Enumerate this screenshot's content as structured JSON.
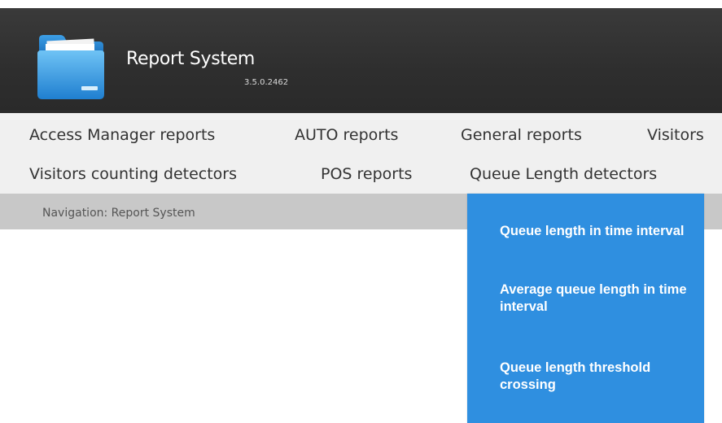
{
  "header": {
    "title": "Report System",
    "version": "3.5.0.2462",
    "logo_icon": "folder-icon"
  },
  "menu": {
    "row1": [
      "Access Manager reports",
      "AUTO reports",
      "General reports",
      "Visitors"
    ],
    "row2": [
      "Visitors counting detectors",
      "POS reports",
      "Queue Length detectors"
    ]
  },
  "breadcrumb": "Navigation: Report System",
  "dropdown": {
    "items": [
      "Queue length in time interval",
      "Average queue length in time interval",
      "Queue length threshold crossing"
    ]
  },
  "colors": {
    "header_bg": "#2e2e2e",
    "menubar_bg": "#f0f0f0",
    "navbar_bg": "#c8c8c8",
    "dropdown_bg": "#2f8fe0",
    "dropdown_text": "#ffffff"
  }
}
